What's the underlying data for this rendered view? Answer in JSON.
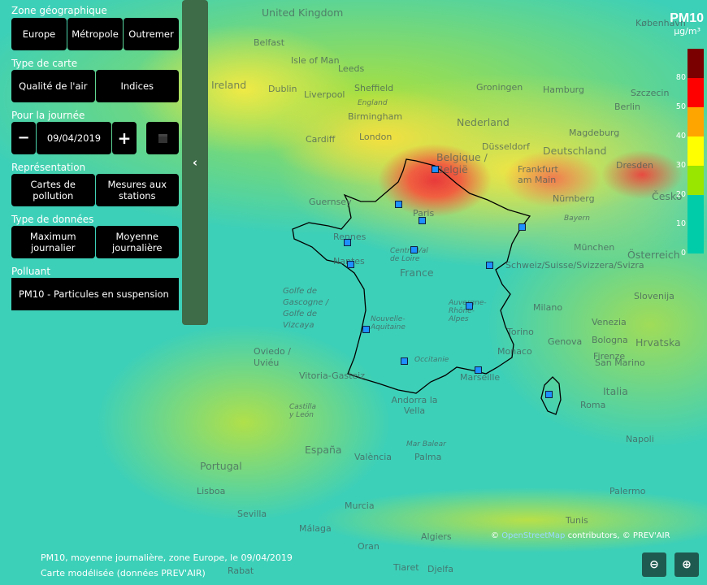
{
  "panel": {
    "zone_label": "Zone géographique",
    "zone_options": [
      "Europe",
      "Métropole",
      "Outremer"
    ],
    "map_type_label": "Type de carte",
    "map_type_options": [
      "Qualité de l'air",
      "Indices"
    ],
    "day_label": "Pour la journée",
    "date": "09/04/2019",
    "minus": "−",
    "plus": "+",
    "repr_label": "Représentation",
    "repr_options": [
      "Cartes de pollution",
      "Mesures aux stations"
    ],
    "data_type_label": "Type de données",
    "data_type_options": [
      "Maximum journalier",
      "Moyenne journalière"
    ],
    "pollutant_label": "Polluant",
    "pollutant": "PM10 - Particules en suspension",
    "collapse": "‹"
  },
  "legend": {
    "title": "PM10",
    "unit": "µg/m³",
    "ticks": [
      "80",
      "50",
      "40",
      "30",
      "20",
      "10",
      "0"
    ],
    "colors": [
      "#7a0000",
      "#ff0000",
      "#ffa500",
      "#ffff00",
      "#99e600",
      "#00ccaa"
    ]
  },
  "caption": {
    "line1": "PM10, moyenne journalière, zone Europe, le 09/04/2019",
    "line2": "Carte modélisée (données PREV'AIR)"
  },
  "attribution": {
    "prefix": "© ",
    "link": "OpenStreetMap",
    "suffix": " contributors, © PREV'AIR"
  },
  "zoom": {
    "out": "🔍−",
    "in": "🔍+"
  },
  "map_labels": [
    "United Kingdom",
    "København",
    "Belfast",
    "Isle of Man",
    "Leeds",
    "Ireland",
    "Dublin",
    "Liverpool",
    "Sheffield",
    "England",
    "Birmingham",
    "Groningen",
    "Hamburg",
    "Szczecin",
    "Nederland",
    "Berlin",
    "Cardiff",
    "London",
    "Düsseldorf",
    "Magdeburg",
    "Deutschland",
    "Belgique / België",
    "Frankfurt am Main",
    "Dresden",
    "Česko",
    "Guernsey",
    "Paris",
    "Nürnberg",
    "Bayern",
    "Rennes",
    "Nantes",
    "Centre-Val de Loire",
    "France",
    "München",
    "Österreich",
    "Schweiz/Suisse/Svizzera/Svizra",
    "Golfe de Gascogne / Golfe de Vizcaya",
    "Auvergne-Rhône-Alpes",
    "Milano",
    "Slovenija",
    "Nouvelle-Aquitaine",
    "Torino",
    "Venezia",
    "Genova",
    "Bologna",
    "Hrvatska",
    "Oviedo / Uviéu",
    "Occitanie",
    "Monaco",
    "Marseille",
    "Firenze",
    "San Marino",
    "Vitoria-Gasteiz",
    "Andorra la Vella",
    "Italia",
    "Roma",
    "Castilla y León",
    "España",
    "València",
    "Mar Balear",
    "Palma",
    "Portugal",
    "Lisboa",
    "Napoli",
    "Palermo",
    "Sevilla",
    "Murcia",
    "Málaga",
    "Algiers",
    "Tunis",
    "Oran",
    "Tiaret",
    "Djelfa",
    "Rabat"
  ]
}
